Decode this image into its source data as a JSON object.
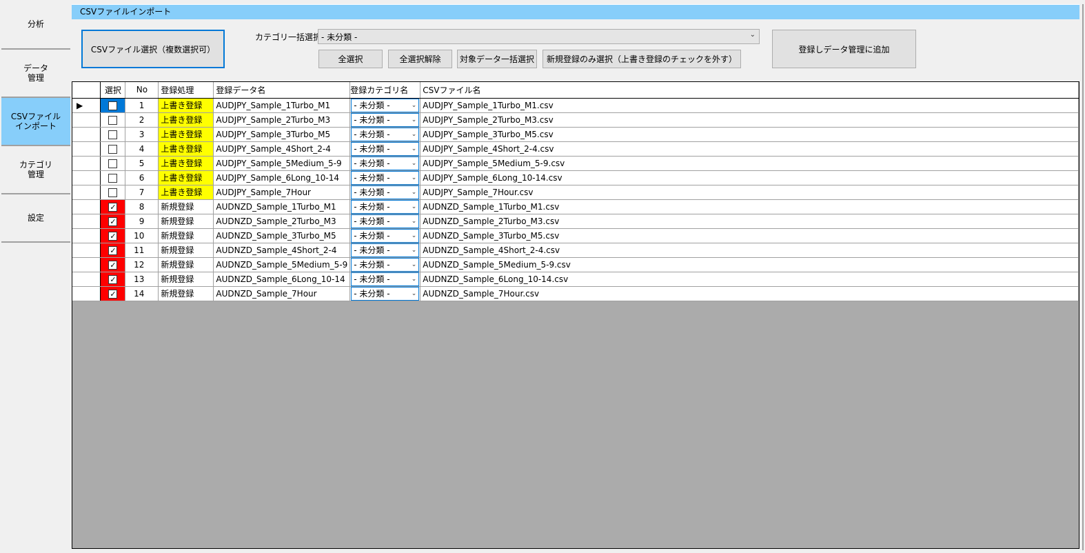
{
  "sidebar": {
    "items": [
      {
        "label": "分析",
        "active": false
      },
      {
        "label": "データ\n管理",
        "active": false
      },
      {
        "label": "CSVファイル\nインポート",
        "active": true
      },
      {
        "label": "カテゴリ\n管理",
        "active": false
      },
      {
        "label": "設定",
        "active": false
      }
    ]
  },
  "header": {
    "title": "CSVファイルインポート"
  },
  "toolbar": {
    "select_csv_label": "CSVファイル選択（複数選択可）",
    "category_bulk_label": "カテゴリ一括選択",
    "category_bulk_value": "- 未分類 -",
    "select_all_label": "全選択",
    "deselect_all_label": "全選択解除",
    "target_bulk_label": "対象データ一括選択",
    "new_only_label": "新規登録のみ選択（上書き登録のチェックを外す）",
    "register_label": "登録しデータ管理に追加"
  },
  "grid": {
    "columns": [
      "選択",
      "No",
      "登録処理",
      "登録データ名",
      "登録カテゴリ名",
      "CSVファイル名"
    ],
    "colors": {
      "overwrite": "#ffff00",
      "checked": "#ff0000",
      "current": "#0078d7"
    },
    "rows": [
      {
        "checked": false,
        "no": "1",
        "proc": "上書き登録",
        "name": "AUDJPY_Sample_1Turbo_M1",
        "cat": "- 未分類 -",
        "file": "AUDJPY_Sample_1Turbo_M1.csv"
      },
      {
        "checked": false,
        "no": "2",
        "proc": "上書き登録",
        "name": "AUDJPY_Sample_2Turbo_M3",
        "cat": "- 未分類 -",
        "file": "AUDJPY_Sample_2Turbo_M3.csv"
      },
      {
        "checked": false,
        "no": "3",
        "proc": "上書き登録",
        "name": "AUDJPY_Sample_3Turbo_M5",
        "cat": "- 未分類 -",
        "file": "AUDJPY_Sample_3Turbo_M5.csv"
      },
      {
        "checked": false,
        "no": "4",
        "proc": "上書き登録",
        "name": "AUDJPY_Sample_4Short_2-4",
        "cat": "- 未分類 -",
        "file": "AUDJPY_Sample_4Short_2-4.csv"
      },
      {
        "checked": false,
        "no": "5",
        "proc": "上書き登録",
        "name": "AUDJPY_Sample_5Medium_5-9",
        "cat": "- 未分類 -",
        "file": "AUDJPY_Sample_5Medium_5-9.csv"
      },
      {
        "checked": false,
        "no": "6",
        "proc": "上書き登録",
        "name": "AUDJPY_Sample_6Long_10-14",
        "cat": "- 未分類 -",
        "file": "AUDJPY_Sample_6Long_10-14.csv"
      },
      {
        "checked": false,
        "no": "7",
        "proc": "上書き登録",
        "name": "AUDJPY_Sample_7Hour",
        "cat": "- 未分類 -",
        "file": "AUDJPY_Sample_7Hour.csv"
      },
      {
        "checked": true,
        "no": "8",
        "proc": "新規登録",
        "name": "AUDNZD_Sample_1Turbo_M1",
        "cat": "- 未分類 -",
        "file": "AUDNZD_Sample_1Turbo_M1.csv"
      },
      {
        "checked": true,
        "no": "9",
        "proc": "新規登録",
        "name": "AUDNZD_Sample_2Turbo_M3",
        "cat": "- 未分類 -",
        "file": "AUDNZD_Sample_2Turbo_M3.csv"
      },
      {
        "checked": true,
        "no": "10",
        "proc": "新規登録",
        "name": "AUDNZD_Sample_3Turbo_M5",
        "cat": "- 未分類 -",
        "file": "AUDNZD_Sample_3Turbo_M5.csv"
      },
      {
        "checked": true,
        "no": "11",
        "proc": "新規登録",
        "name": "AUDNZD_Sample_4Short_2-4",
        "cat": "- 未分類 -",
        "file": "AUDNZD_Sample_4Short_2-4.csv"
      },
      {
        "checked": true,
        "no": "12",
        "proc": "新規登録",
        "name": "AUDNZD_Sample_5Medium_5-9",
        "cat": "- 未分類 -",
        "file": "AUDNZD_Sample_5Medium_5-9.csv"
      },
      {
        "checked": true,
        "no": "13",
        "proc": "新規登録",
        "name": "AUDNZD_Sample_6Long_10-14",
        "cat": "- 未分類 -",
        "file": "AUDNZD_Sample_6Long_10-14.csv"
      },
      {
        "checked": true,
        "no": "14",
        "proc": "新規登録",
        "name": "AUDNZD_Sample_7Hour",
        "cat": "- 未分類 -",
        "file": "AUDNZD_Sample_7Hour.csv"
      }
    ]
  }
}
